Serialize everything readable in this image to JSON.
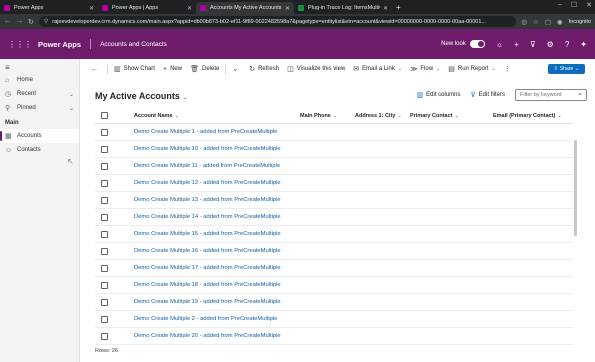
{
  "browser": {
    "tabs": [
      {
        "label": "Power Apps",
        "active": false
      },
      {
        "label": "Power Apps | Apps",
        "active": false
      },
      {
        "label": "Accounts My Active Accounts",
        "active": true
      },
      {
        "label": "Plug-in Trace Log: ItemsMultiG...",
        "active": false
      }
    ],
    "url": "rajeevdeveloperdev.crm.dynamics.com/main.aspx?appid=db00b873-b02-ef11-9f89-0022482598a7&pagetype=entitylist&etn=account&viewid=00000000-0000-0000-00aa-00001...",
    "profile": "Incognito"
  },
  "app": {
    "brand": "Power Apps",
    "name": "Accounts and Contacts",
    "new_look_label": "New look"
  },
  "sidebar": {
    "items": [
      {
        "label": "Home",
        "icon": "home-icon"
      },
      {
        "label": "Recent",
        "icon": "clock-icon"
      },
      {
        "label": "Pinned",
        "icon": "pin-icon"
      }
    ],
    "group_label": "Main",
    "entities": [
      {
        "label": "Accounts",
        "icon": "building-icon",
        "selected": true
      },
      {
        "label": "Contacts",
        "icon": "person-icon",
        "selected": false
      }
    ]
  },
  "commands": {
    "show_chart": "Show Chart",
    "new": "New",
    "delete": "Delete",
    "refresh": "Refresh",
    "visualize": "Visualize this view",
    "email_link": "Email a Link",
    "flow": "Flow",
    "run_report": "Run Report",
    "share": "Share"
  },
  "view": {
    "title": "My Active Accounts",
    "edit_columns": "Edit columns",
    "edit_filters": "Edit filters",
    "filter_placeholder": "Filter by keyword"
  },
  "grid": {
    "columns": [
      "Account Name",
      "Main Phone",
      "Address 1: City",
      "Primary Contact",
      "Email (Primary Contact)"
    ],
    "rows": [
      "Demo Create Multiple 1 - added from PreCreateMultiple",
      "Demo Create Multiple 10 - added from PreCreateMultiple",
      "Demo Create Multiple 11 - added from PreCreateMultiple",
      "Demo Create Multiple 12 - added from PreCreateMultiple",
      "Demo Create Multiple 13 - added from PreCreateMultiple",
      "Demo Create Multiple 14 - added from PreCreateMultiple",
      "Demo Create Multiple 15 - added from PreCreateMultiple",
      "Demo Create Multiple 16 - added from PreCreateMultiple",
      "Demo Create Multiple 17 - added from PreCreateMultiple",
      "Demo Create Multiple 18 - added from PreCreateMultiple",
      "Demo Create Multiple 19 - added from PreCreateMultiple",
      "Demo Create Multiple 2 - added from PreCreateMultiple",
      "Demo Create Multiple 20 - added from PreCreateMultiple"
    ],
    "row_count": "Rows: 26"
  },
  "colors": {
    "header": "#701c6c",
    "accent": "#0f6cbd",
    "link": "#115ea3"
  }
}
